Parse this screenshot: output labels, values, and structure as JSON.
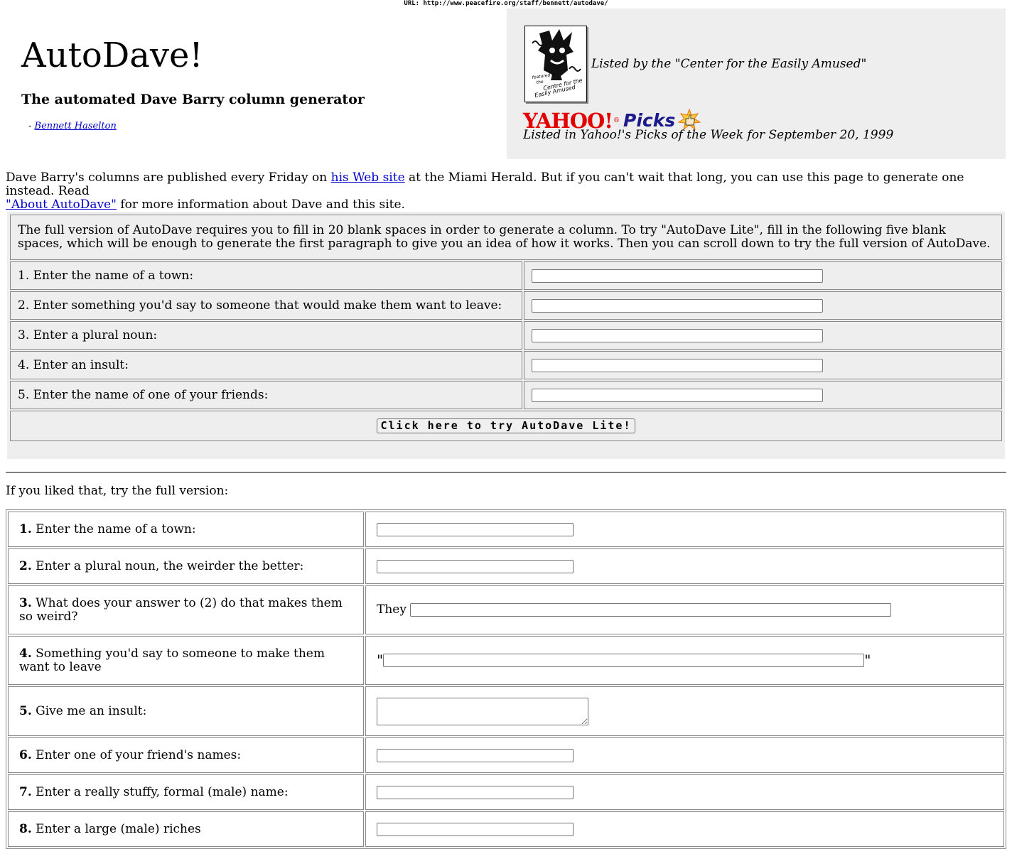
{
  "url_bar": "URL: http://www.peacefire.org/staff/bennett/autodave/",
  "header": {
    "title": "AutoDave!",
    "subtitle": "The automated Dave Barry column generator",
    "byline_prefix": "- ",
    "byline_link": "Bennett Haselton"
  },
  "awards": {
    "cea_badge_lines": [
      "featured in",
      "the",
      "Centre for the",
      "Easily Amused"
    ],
    "cea_text": "Listed by the \"Center for the Easily Amused\"",
    "yahoo_logo": "YAHOO!",
    "yahoo_reg": "®",
    "picks_label": "Picks",
    "yahoo_text": "Listed in Yahoo!'s Picks of the Week for September 20, 1999"
  },
  "intro": {
    "part1": "Dave Barry's columns are published every Friday on ",
    "link1": "his Web site",
    "part2": " at the Miami Herald. But if you can't wait that long, you can use this page to generate one instead. Read ",
    "link2": "\"About AutoDave\"",
    "part3": " for more information about Dave and this site."
  },
  "lite": {
    "description": "The full version of AutoDave requires you to fill in 20 blank spaces in order to generate a column. To try \"AutoDave Lite\", fill in the following five blank spaces, which will be enough to generate the first paragraph to give you an idea of how it works. Then you can scroll down to try the full version of AutoDave.",
    "fields": [
      {
        "label": "1. Enter the name of a town:",
        "value": ""
      },
      {
        "label": "2. Enter something you'd say to someone that would make them want to leave:",
        "value": ""
      },
      {
        "label": "3. Enter a plural noun:",
        "value": ""
      },
      {
        "label": "4. Enter an insult:",
        "value": ""
      },
      {
        "label": "5. Enter the name of one of your friends:",
        "value": ""
      }
    ],
    "button": "Click here to try AutoDave Lite!"
  },
  "full": {
    "intro": "If you liked that, try the full version:",
    "fields": [
      {
        "num": "1.",
        "label": " Enter the name of a town:",
        "value": ""
      },
      {
        "num": "2.",
        "label": " Enter a plural noun, the weirder the better:",
        "value": ""
      },
      {
        "num": "3.",
        "label": " What does your answer to (2) do that makes them so weird?",
        "prefix": "They",
        "value": ""
      },
      {
        "num": "4.",
        "label": " Something you'd say to someone to make them want to leave",
        "open_quote": "\"",
        "close_quote": "\"",
        "value": ""
      },
      {
        "num": "5.",
        "label": " Give me an insult:",
        "value": ""
      },
      {
        "num": "6.",
        "label": " Enter one of your friend's names:",
        "value": ""
      },
      {
        "num": "7.",
        "label": " Enter a really stuffy, formal (male) name:",
        "value": ""
      },
      {
        "num": "8.",
        "label": " Enter a large (male) riches",
        "value": ""
      }
    ]
  }
}
